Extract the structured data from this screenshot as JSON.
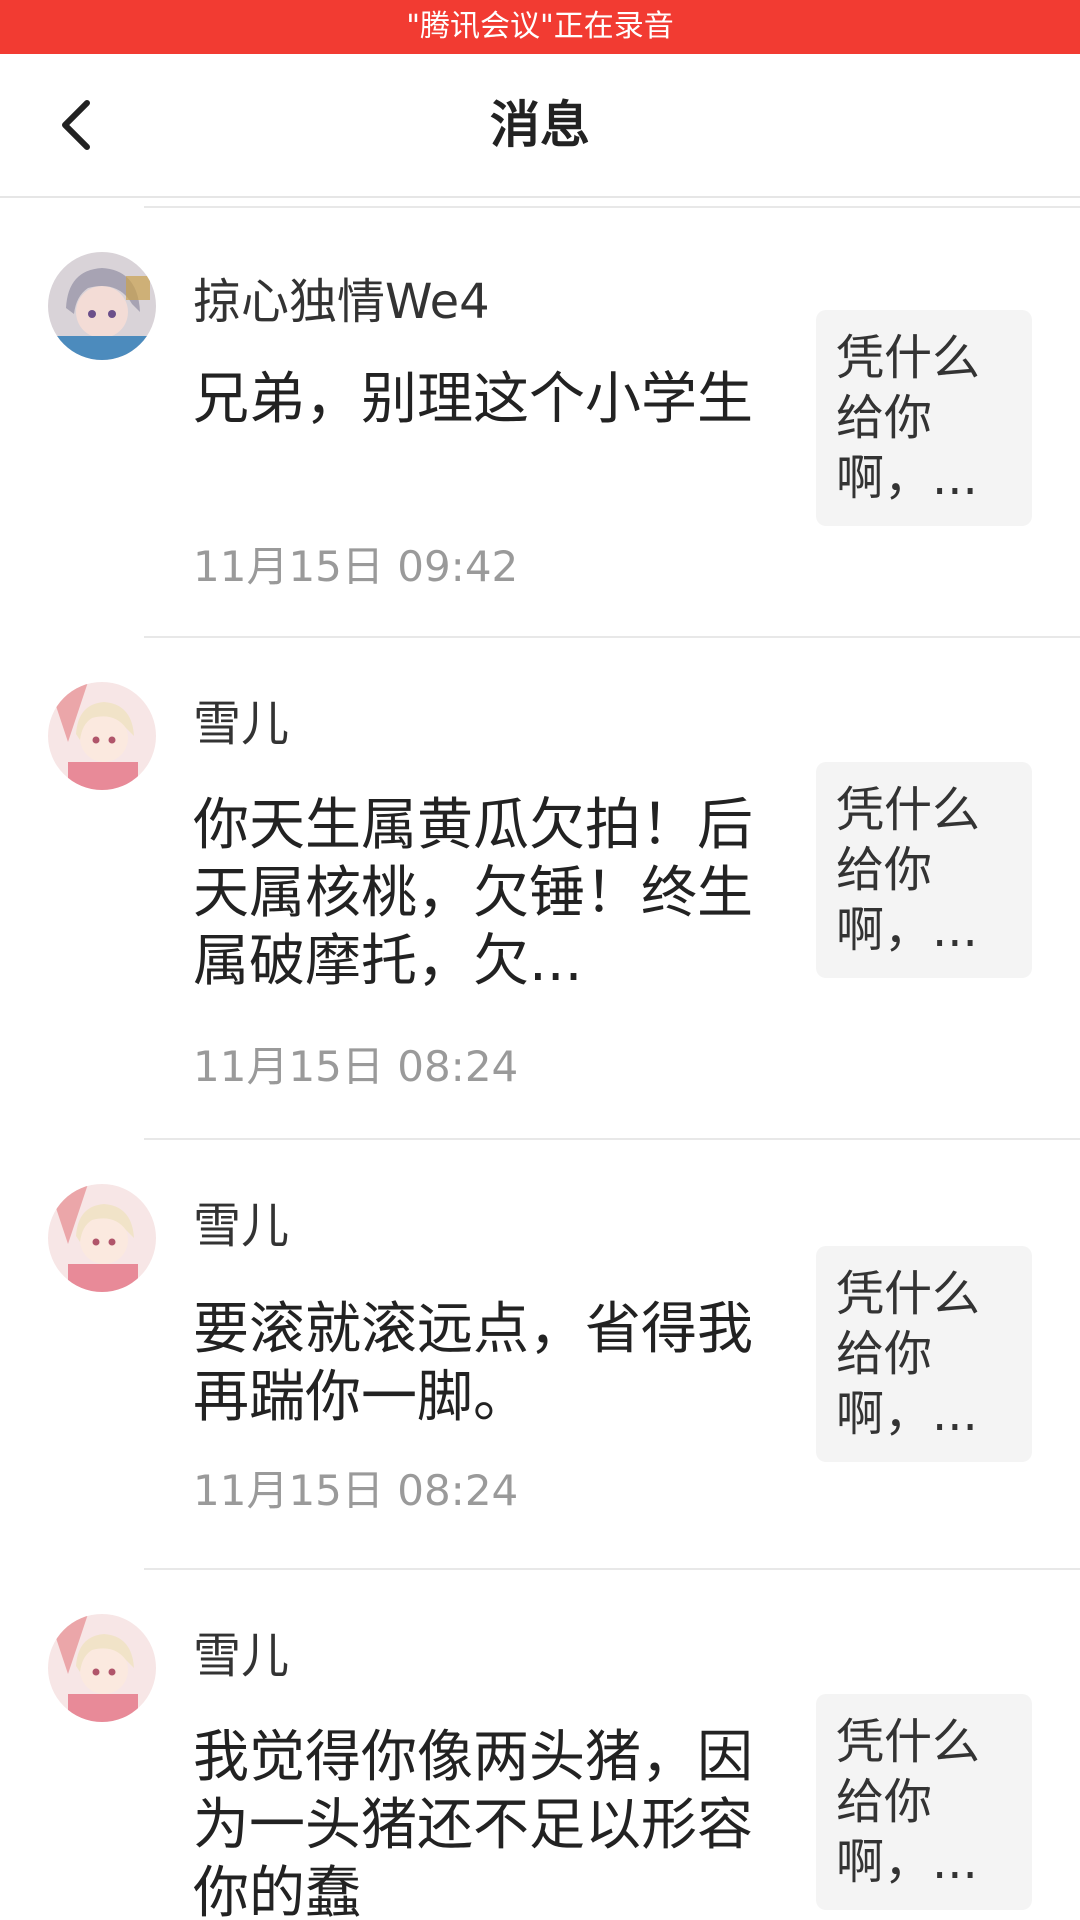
{
  "banner": {
    "text": "\"腾讯会议\"正在录音"
  },
  "header": {
    "title": "消息",
    "back_icon": "chevron-left-icon"
  },
  "messages": [
    {
      "username": "掠心独情We4",
      "text": "兄弟，别理这个小学生",
      "time": "11月15日 09:42",
      "preview": "凭什么给你啊，...",
      "avatar": "avatar-anime-silver-hair"
    },
    {
      "username": "雪儿",
      "text": "你天生属黄瓜欠拍！后天属核桃，欠锤！终生属破摩托，欠...",
      "time": "11月15日 08:24",
      "preview": "凭什么给你啊，...",
      "avatar": "avatar-anime-pink-cat"
    },
    {
      "username": "雪儿",
      "text": "要滚就滚远点，省得我再踹你一脚。",
      "time": "11月15日 08:24",
      "preview": "凭什么给你啊，...",
      "avatar": "avatar-anime-pink-cat"
    },
    {
      "username": "雪儿",
      "text": "我觉得你像两头猪，因为一头猪还不足以形容你的蠢",
      "time": "",
      "preview": "凭什么给你啊，...",
      "avatar": "avatar-anime-pink-cat"
    }
  ],
  "colors": {
    "banner_bg": "#f23b32",
    "text_primary": "#222222",
    "text_secondary": "#9a9a9a",
    "thumb_bg": "#f4f4f4"
  }
}
